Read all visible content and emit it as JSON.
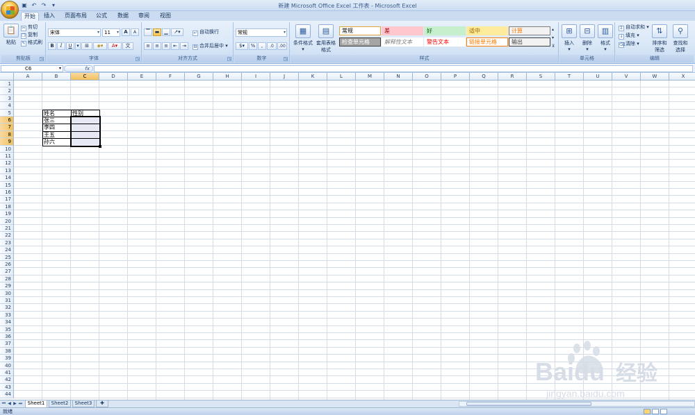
{
  "window_title": "新建 Microsoft Office Excel 工作表 - Microsoft Excel",
  "tabs": [
    "开始",
    "插入",
    "页面布局",
    "公式",
    "数据",
    "审阅",
    "视图"
  ],
  "active_tab": "开始",
  "ribbon": {
    "clipboard": {
      "label": "剪贴板",
      "paste": "粘贴",
      "cut": "剪切",
      "copy": "复制",
      "format_painter": "格式刷"
    },
    "font": {
      "label": "字体",
      "font_name": "宋体",
      "font_size": "11",
      "bold": "B",
      "italic": "I",
      "underline": "U",
      "grow": "A",
      "shrink": "A"
    },
    "alignment": {
      "label": "对齐方式",
      "wrap": "自动换行",
      "merge": "合并后居中"
    },
    "number": {
      "label": "数字",
      "format": "常规",
      "percent": "%",
      "comma": ","
    },
    "styles": {
      "label": "样式",
      "conditional": "条件格式",
      "table_format": "套用表格格式",
      "cells": [
        {
          "text": "常规",
          "bg": "#ffffff",
          "fg": "#000000",
          "border": "#e2a33d"
        },
        {
          "text": "差",
          "bg": "#ffc7ce",
          "fg": "#9c0006",
          "border": "#ffc7ce"
        },
        {
          "text": "好",
          "bg": "#c6efce",
          "fg": "#006100",
          "border": "#c6efce"
        },
        {
          "text": "适中",
          "bg": "#ffeb9c",
          "fg": "#9c6500",
          "border": "#ffeb9c"
        },
        {
          "text": "计算",
          "bg": "#f2f2f2",
          "fg": "#fa7d00",
          "border": "#7f7f7f"
        },
        {
          "text": "检查单元格",
          "bg": "#a5a5a5",
          "fg": "#ffffff",
          "border": "#3f3f3f"
        },
        {
          "text": "解释性文本",
          "bg": "#ffffff",
          "fg": "#7f7f7f",
          "border": "#ffffff"
        },
        {
          "text": "警告文本",
          "bg": "#ffffff",
          "fg": "#ff0000",
          "border": "#ffffff"
        },
        {
          "text": "链接单元格",
          "bg": "#ffffff",
          "fg": "#fa7d00",
          "border": "#ff8001"
        },
        {
          "text": "输出",
          "bg": "#f2f2f2",
          "fg": "#3f3f3f",
          "border": "#3f3f3f"
        }
      ]
    },
    "cells": {
      "label": "单元格",
      "insert": "插入",
      "delete": "删除",
      "format": "格式"
    },
    "editing": {
      "label": "编辑",
      "autosum": "自动求和",
      "fill": "填充",
      "clear": "清除",
      "sort": "排序和筛选",
      "find": "查找和选择"
    }
  },
  "formula_bar": {
    "name_box": "C6",
    "fx": "fx",
    "value": ""
  },
  "grid": {
    "columns": [
      "A",
      "B",
      "C",
      "D",
      "E",
      "F",
      "G",
      "H",
      "I",
      "J",
      "K",
      "L",
      "M",
      "N",
      "O",
      "P",
      "Q",
      "R",
      "S",
      "T",
      "U",
      "V",
      "W",
      "X"
    ],
    "rows": 44,
    "selected_column": "C",
    "selected_rows": [
      6,
      7,
      8,
      9
    ],
    "cells": [
      {
        "ref": "B5",
        "text": "姓名"
      },
      {
        "ref": "C5",
        "text": "性别"
      },
      {
        "ref": "B6",
        "text": "张三"
      },
      {
        "ref": "B7",
        "text": "李四"
      },
      {
        "ref": "B8",
        "text": "王五"
      },
      {
        "ref": "B9",
        "text": "孙六"
      }
    ]
  },
  "sheets": [
    "Sheet1",
    "Sheet2",
    "Sheet3"
  ],
  "active_sheet": "Sheet1",
  "status": "就绪",
  "watermark": {
    "brand": "Baidu",
    "cn": "经验",
    "url": "jingyan.baidu.com"
  }
}
